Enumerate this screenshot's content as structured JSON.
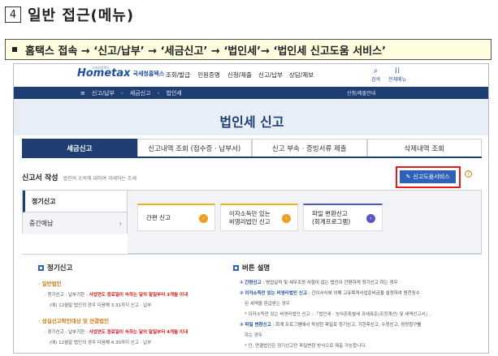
{
  "section": {
    "number": "4",
    "title": "일반 접근(메뉴)"
  },
  "path_banner": "홈택스 접속 → ‘신고/납부’ → ‘세금신고’ → ‘법인세’→ ‘법인세 신고도움 서비스’",
  "header": {
    "logo_main": "Hometax",
    "logo_sub": "국세청홈택스",
    "logo_tiny": "국세청홈택스",
    "nav": [
      "조회/발급",
      "민원증명",
      "신청/제출",
      "신고/납부",
      "상담/제보"
    ],
    "search_label": "검색",
    "all_menu_label": "전체메뉴"
  },
  "breadcrumb": {
    "items": [
      "신고/납부",
      "세금신고",
      "법인세"
    ],
    "right": "신청/제출안내"
  },
  "hero": {
    "title": "법인세 신고"
  },
  "tabs": [
    "세금신고",
    "신고내역 조회 (접수증 · 납부서)",
    "신고 부속 · 증빙서류 제출",
    "삭제내역 조회"
  ],
  "filing": {
    "title": "신고서 작성",
    "desc": "법인의 소득에 대하여 과세하는 조세",
    "service_button": "신고도움서비스",
    "help": "?"
  },
  "side_menu": [
    {
      "label": "정기신고",
      "active": true
    },
    {
      "label": "중간예납",
      "active": false,
      "arrow": "›"
    }
  ],
  "cards": [
    {
      "line1": "간편 신고",
      "line2": ""
    },
    {
      "line1": "이자소득만 있는",
      "line2": "비영리법인 신고"
    },
    {
      "line1": "파일 변환신고",
      "line2": "(회계프로그램)"
    }
  ],
  "left_column": {
    "title": "정기신고",
    "sub1": "· 일반법인",
    "sub1_line1_prefix": "· 정기신고 · 납부기한 : ",
    "sub1_line1_red": "사업연도 종료일이 속하는 달의 말일부터 3개월 이내",
    "sub1_line2": "(예) 12월말 법인의 경우 다음해 3.31까지 신고 · 납부",
    "sub2": "· 성실신고확인대상 및 연결법인",
    "sub2_line1_prefix": "· 정기신고 · 납부기한 : ",
    "sub2_line1_red": "사업연도 종료일이 속하는 달의 말일부터 4개월 이내",
    "sub2_line2": "(예) 12월말 법인의 경우 다음해 4.30까지 신고 · 납부"
  },
  "right_column": {
    "title": "버튼 설명",
    "items": [
      {
        "num": "①",
        "name": "간편신고",
        "text": " : 영업실적 및 세무조정 사항이 없는 법인이 간편하게 정기신고 하는 경우"
      },
      {
        "num": "②",
        "name": "이자소득만 있는 비영리법인 신고",
        "text": " : 간이서식에 의해 고유목적사업준비금을 설정하여 원천징수"
      },
      {
        "num": "",
        "name": "",
        "text": "된 세액을 환급받는 경우"
      },
      {
        "num": "",
        "name": "",
        "text": "* 이자소득만 있는 비영리법인 신고 : 「법인세 · 농어촌특별세 과세표준(조정계산) 및 세액신고서」,"
      },
      {
        "num": "③",
        "name": "파일 변환신고",
        "text": " : 회계 프로그램에서 작성한 파일로 정기신고, 기한후신고, 수정신고, 경정청구를"
      },
      {
        "num": "",
        "name": "",
        "text": "하는 경우"
      },
      {
        "num": "",
        "name": "",
        "text": "* 단, 연결법인은 정기신고만 파일변환 방식으로 제출 가능합니다."
      }
    ]
  },
  "colors": {
    "navy": "#1f3f74",
    "accent_blue": "#2f62b7",
    "highlight_red": "#e01c1c",
    "orange": "#f0a020"
  }
}
